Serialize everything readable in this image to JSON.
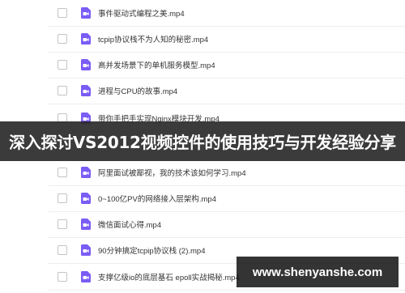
{
  "file_list": {
    "items": [
      {
        "name": "事件驱动式编程之美.mp4"
      },
      {
        "name": "tcpip协议栈不为人知的秘密.mp4"
      },
      {
        "name": "高并发场景下的单机服务模型.mp4"
      },
      {
        "name": "进程与CPU的故事.mp4"
      },
      {
        "name": "带你手把手实现Nginx模块开发.mp4"
      },
      {
        "name": "阿里面试被鄙视，我的技术该如何学习.mp4"
      },
      {
        "name": "0~100亿PV的网络接入层架构.mp4"
      },
      {
        "name": "微信面试心得.mp4"
      },
      {
        "name": "90分钟搞定tcpip协议栈 (2).mp4"
      },
      {
        "name": "支撑亿级io的底层基石 epoll实战揭秘.mp4"
      }
    ]
  },
  "banner": {
    "title": "深入探讨VS2012视频控件的使用技巧与开发经验分享"
  },
  "watermark": {
    "text": "www.shenyanshe.com"
  },
  "colors": {
    "video_icon": "#7B5CF5",
    "banner_bg": "#262626"
  },
  "icons": {
    "file_type": "video-file-icon"
  }
}
